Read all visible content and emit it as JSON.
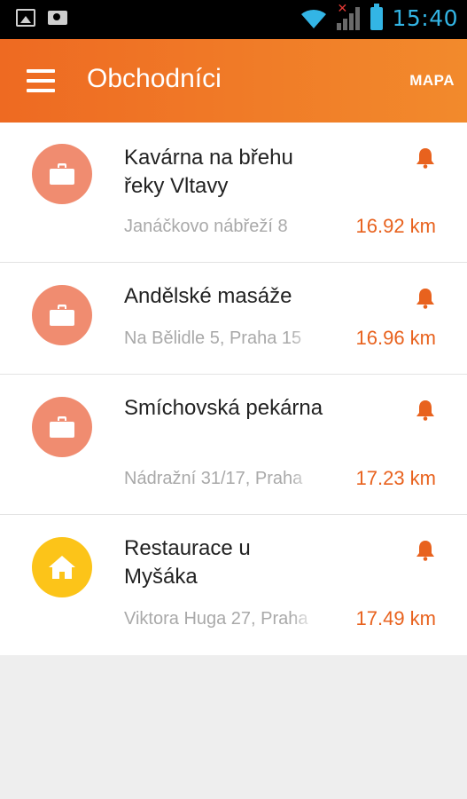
{
  "status_bar": {
    "time": "15:40",
    "icons": [
      "gallery-icon",
      "camera-icon",
      "wifi-icon",
      "signal-no-sim-icon",
      "battery-icon"
    ],
    "accent_color": "#33b5e5"
  },
  "app_bar": {
    "title": "Obchodníci",
    "map_action": "MAPA",
    "menu_icon": "hamburger-menu-icon",
    "gradient_colors": [
      "#ee6a22",
      "#f28a2c"
    ]
  },
  "merchants": [
    {
      "name": "Kavárna na břehu řeky Vltavy",
      "address": "Janáčkovo nábřeží 8",
      "distance": "16.92 km",
      "icon": "briefcase-icon",
      "icon_color": "#f08c70"
    },
    {
      "name": "Andělské masáže",
      "address": "Na Bělidle 5, Praha 15",
      "distance": "16.96 km",
      "icon": "briefcase-icon",
      "icon_color": "#f08c70"
    },
    {
      "name": "Smíchovská pekárna",
      "address": "Nádražní 31/17, Praha",
      "distance": "17.23 km",
      "icon": "briefcase-icon",
      "icon_color": "#f08c70"
    },
    {
      "name": "Restaurace u Myšáka",
      "address": "Viktora Huga 27, Praha",
      "distance": "17.49 km",
      "icon": "home-icon",
      "icon_color": "#fcc419"
    }
  ],
  "colors": {
    "accent": "#e8621e",
    "bell": "#e8621e",
    "secondary_text": "#a9a9a9"
  }
}
